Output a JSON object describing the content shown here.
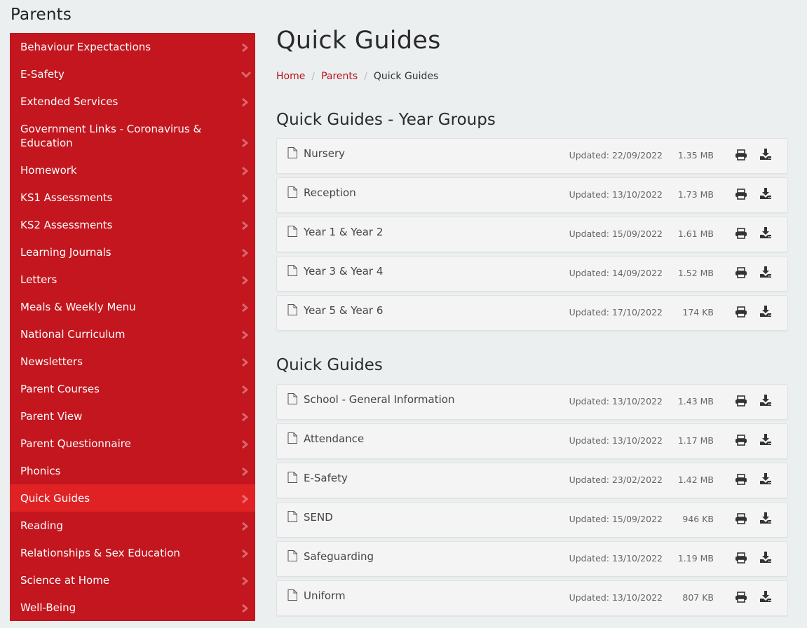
{
  "sidebar": {
    "title": "Parents",
    "items": [
      {
        "label": "Behaviour Expectactions",
        "icon": "chevron-right-icon"
      },
      {
        "label": "E-Safety",
        "icon": "chevron-down-icon"
      },
      {
        "label": "Extended Services",
        "icon": "chevron-right-icon"
      },
      {
        "label": "Government Links - Coronavirus & Education",
        "icon": "chevron-right-icon"
      },
      {
        "label": "Homework",
        "icon": "chevron-right-icon"
      },
      {
        "label": "KS1 Assessments",
        "icon": "chevron-right-icon"
      },
      {
        "label": "KS2 Assessments",
        "icon": "chevron-right-icon"
      },
      {
        "label": "Learning Journals",
        "icon": "chevron-right-icon"
      },
      {
        "label": "Letters",
        "icon": "chevron-right-icon"
      },
      {
        "label": "Meals & Weekly Menu",
        "icon": "chevron-right-icon"
      },
      {
        "label": "National Curriculum",
        "icon": "chevron-right-icon"
      },
      {
        "label": "Newsletters",
        "icon": "chevron-right-icon"
      },
      {
        "label": "Parent Courses",
        "icon": "chevron-right-icon"
      },
      {
        "label": "Parent View",
        "icon": "chevron-right-icon"
      },
      {
        "label": "Parent Questionnaire",
        "icon": "chevron-right-icon"
      },
      {
        "label": "Phonics",
        "icon": "chevron-right-icon"
      },
      {
        "label": "Quick Guides",
        "icon": "chevron-right-icon",
        "active": true
      },
      {
        "label": "Reading",
        "icon": "chevron-right-icon"
      },
      {
        "label": "Relationships & Sex Education",
        "icon": "chevron-right-icon"
      },
      {
        "label": "Science at Home",
        "icon": "chevron-right-icon"
      },
      {
        "label": "Well-Being",
        "icon": "chevron-right-icon"
      }
    ]
  },
  "page": {
    "title": "Quick Guides",
    "breadcrumb": [
      {
        "label": "Home",
        "link": true
      },
      {
        "label": "Parents",
        "link": true
      },
      {
        "label": "Quick Guides",
        "link": false
      }
    ],
    "breadcrumb_separator": "/"
  },
  "sections": [
    {
      "title": "Quick Guides - Year Groups",
      "files": [
        {
          "name": "Nursery",
          "updated": "Updated: 22/09/2022",
          "size": "1.35 MB"
        },
        {
          "name": "Reception",
          "updated": "Updated: 13/10/2022",
          "size": "1.73 MB"
        },
        {
          "name": "Year 1 & Year 2",
          "updated": "Updated: 15/09/2022",
          "size": "1.61 MB"
        },
        {
          "name": "Year 3 & Year 4",
          "updated": "Updated: 14/09/2022",
          "size": "1.52 MB"
        },
        {
          "name": "Year 5 & Year 6",
          "updated": "Updated: 17/10/2022",
          "size": "174 KB"
        }
      ]
    },
    {
      "title": "Quick Guides",
      "files": [
        {
          "name": "School - General Information",
          "updated": "Updated: 13/10/2022",
          "size": "1.43 MB"
        },
        {
          "name": "Attendance",
          "updated": "Updated: 13/10/2022",
          "size": "1.17 MB"
        },
        {
          "name": "E-Safety",
          "updated": "Updated: 23/02/2022",
          "size": "1.42 MB"
        },
        {
          "name": "SEND",
          "updated": "Updated: 15/09/2022",
          "size": "946 KB"
        },
        {
          "name": "Safeguarding",
          "updated": "Updated: 13/10/2022",
          "size": "1.19 MB"
        },
        {
          "name": "Uniform",
          "updated": "Updated: 13/10/2022",
          "size": "807 KB"
        }
      ]
    }
  ],
  "colors": {
    "brand_red": "#c3161e",
    "active_red": "#e12224",
    "link_red": "#b5121b",
    "background": "#eceff0"
  }
}
